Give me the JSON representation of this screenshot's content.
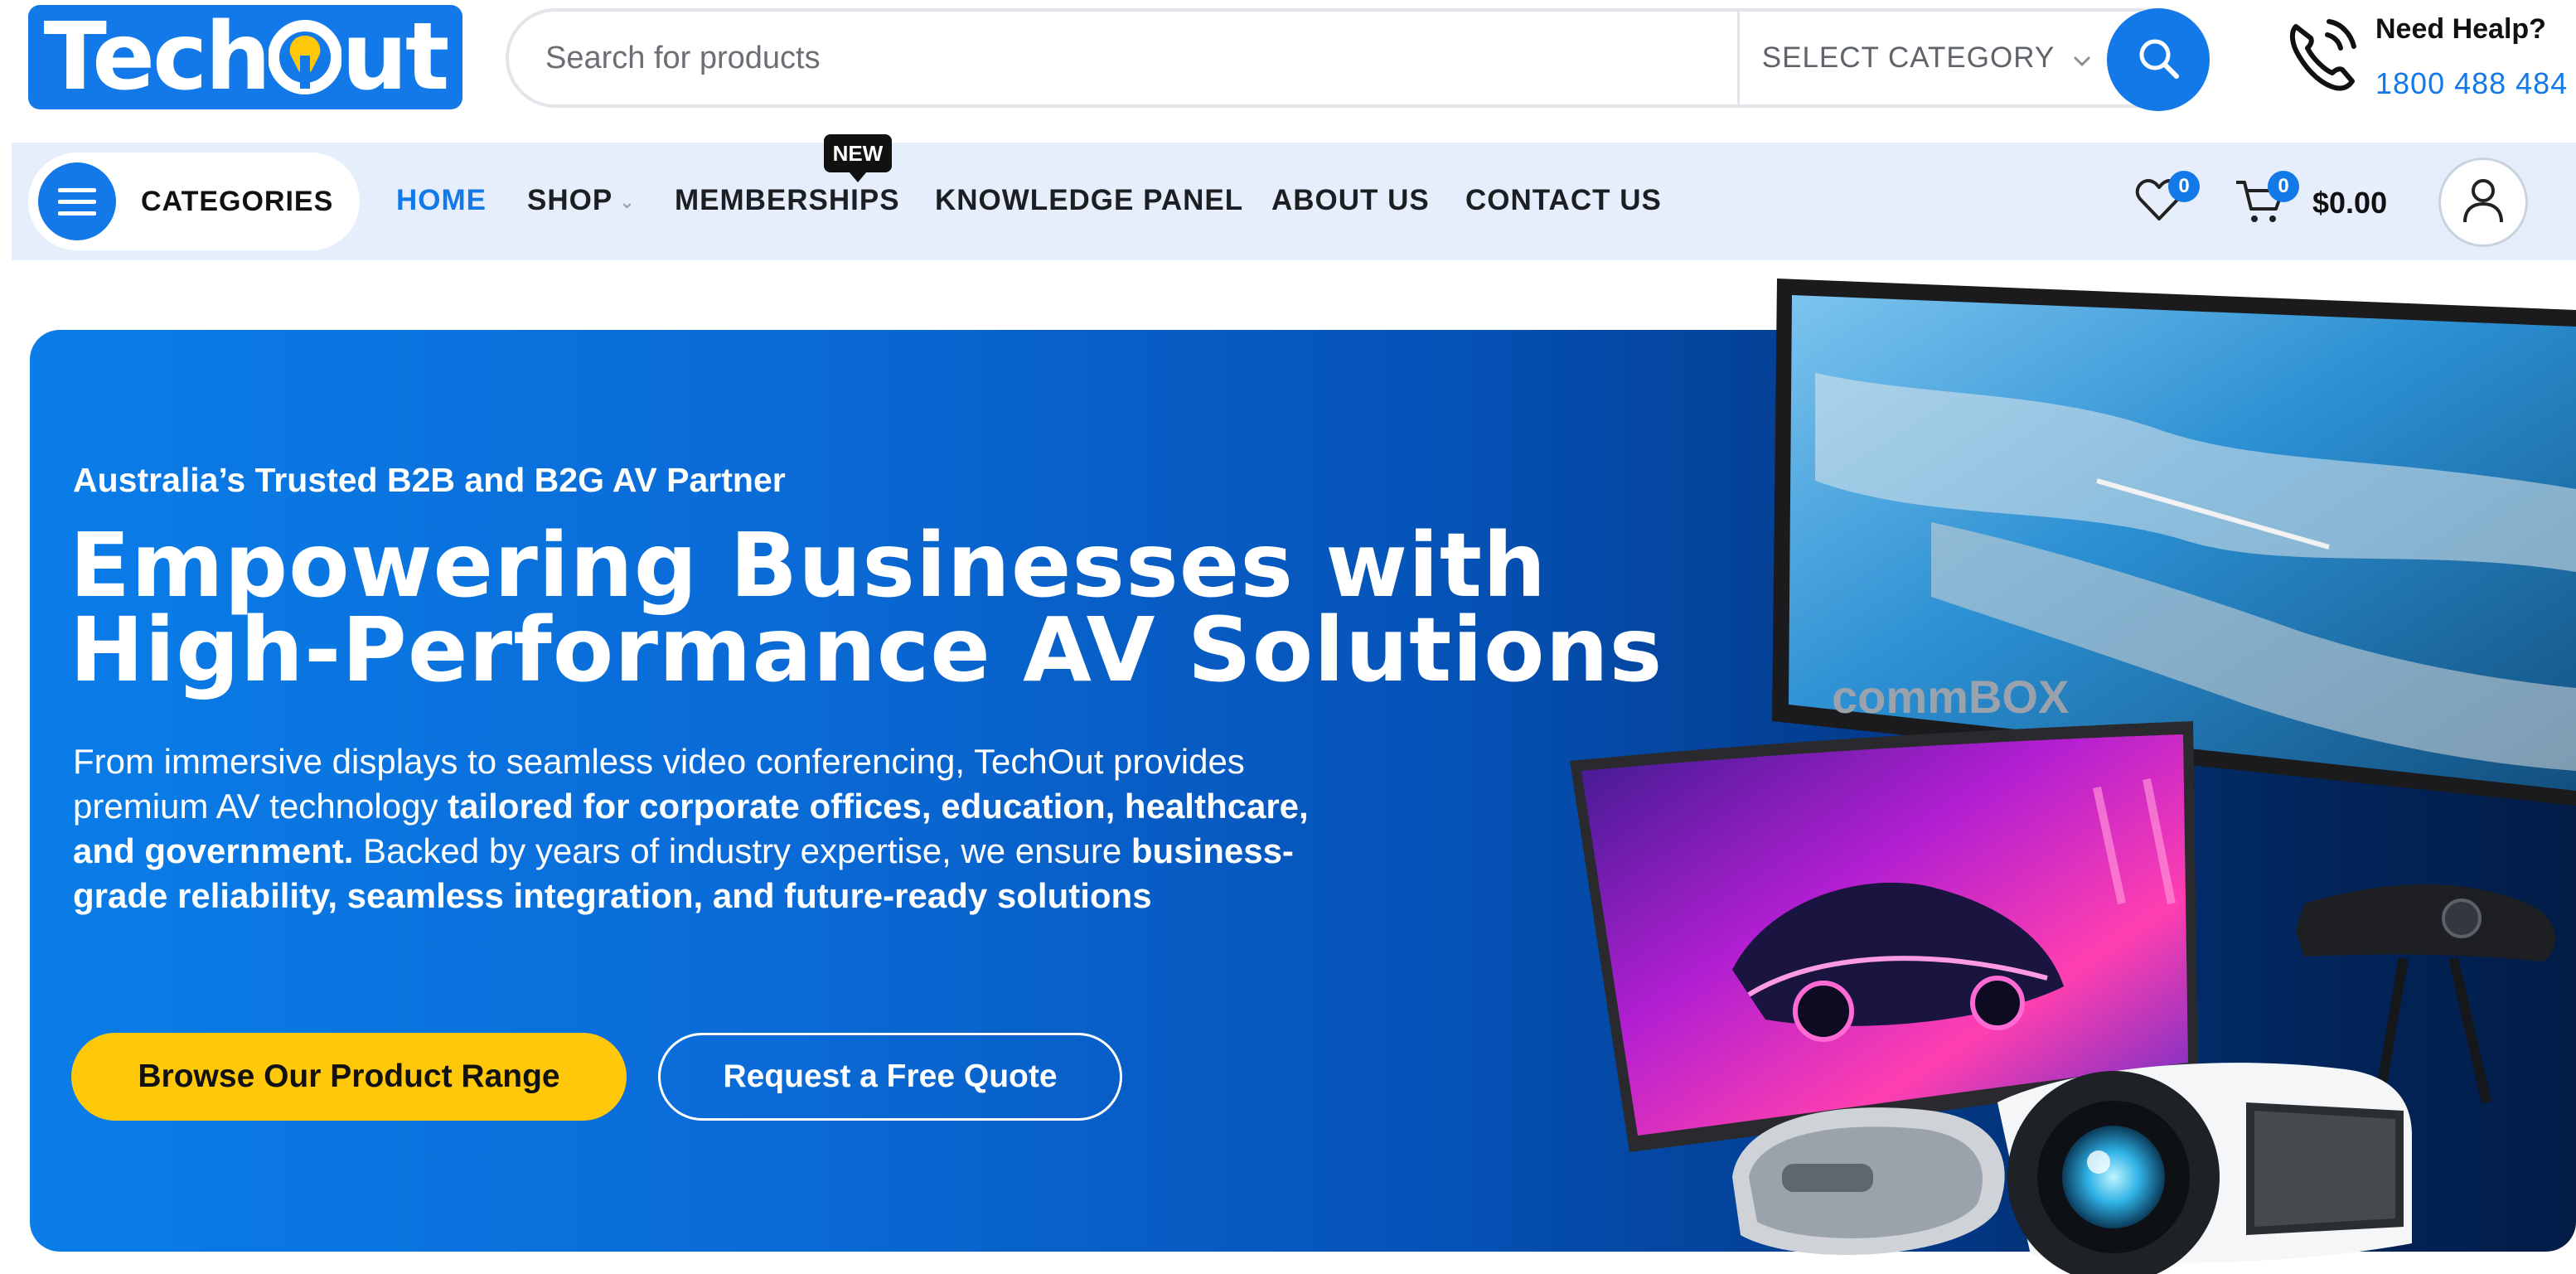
{
  "brand": {
    "logo_text_1": "Tech",
    "logo_text_2": "ut",
    "color": "#1479e8"
  },
  "search": {
    "placeholder": "Search for products",
    "category_label": "SELECT CATEGORY",
    "search_icon": "search-icon"
  },
  "help": {
    "title": "Need Healp?",
    "phone": "1800 488 484",
    "icon": "phone-icon"
  },
  "nav": {
    "categories_label": "CATEGORIES",
    "items": [
      {
        "label": "HOME",
        "active": true
      },
      {
        "label": "SHOP",
        "has_dropdown": true
      },
      {
        "label": "MEMBERSHIPS",
        "badge": "NEW"
      },
      {
        "label": "KNOWLEDGE PANEL"
      },
      {
        "label": "ABOUT US"
      },
      {
        "label": "CONTACT US"
      }
    ],
    "wishlist_count": "0",
    "cart_count": "0",
    "cart_total": "$0.00"
  },
  "hero": {
    "eyebrow": "Australia’s Trusted B2B and B2G AV Partner",
    "title_line_1": "Empowering Businesses with",
    "title_line_2": "High-Performance AV Solutions",
    "body": [
      {
        "text": "From immersive displays to seamless video conferencing, TechOut provides premium AV technology ",
        "bold": false
      },
      {
        "text": "tailored for corporate offices, education, healthcare, and government.",
        "bold": true
      },
      {
        "text": " Backed by years of industry expertise, we ensure ",
        "bold": false
      },
      {
        "text": "business-grade reliability, seamless integration, and future-ready solutions",
        "bold": true
      }
    ],
    "primary_button": "Browse Our Product Range",
    "secondary_button": "Request a Free Quote",
    "gradient_start": "#0a7de8",
    "gradient_end": "#021c47",
    "button_yellow": "#ffc80a"
  },
  "products": {
    "display_brand": "commBOX"
  }
}
